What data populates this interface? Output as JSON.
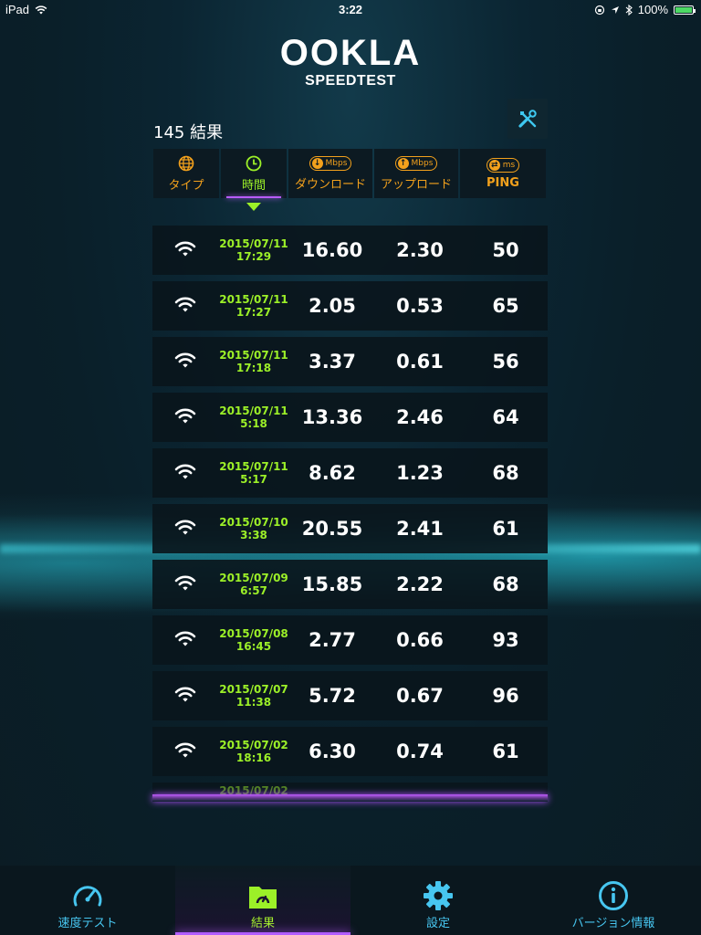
{
  "status_bar": {
    "carrier": "iPad",
    "time": "3:22",
    "battery": "100%",
    "battery_level": 1.0
  },
  "logo": {
    "brand": "OOKLA",
    "product": "SPEEDTEST"
  },
  "results": {
    "count_label": "145 結果",
    "columns": [
      {
        "label": "タイプ",
        "icon": "globe-icon"
      },
      {
        "label": "時間",
        "icon": "clock-icon",
        "active": true
      },
      {
        "label": "ダウンロード",
        "icon": "download-icon",
        "unit": "Mbps"
      },
      {
        "label": "アップロード",
        "icon": "upload-icon",
        "unit": "Mbps"
      },
      {
        "label": "PING",
        "icon": "ping-icon",
        "unit": "ms"
      }
    ],
    "rows": [
      {
        "date": "2015/07/11",
        "time": "17:29",
        "download": "16.60",
        "upload": "2.30",
        "ping": "50"
      },
      {
        "date": "2015/07/11",
        "time": "17:27",
        "download": "2.05",
        "upload": "0.53",
        "ping": "65"
      },
      {
        "date": "2015/07/11",
        "time": "17:18",
        "download": "3.37",
        "upload": "0.61",
        "ping": "56"
      },
      {
        "date": "2015/07/11",
        "time": "5:18",
        "download": "13.36",
        "upload": "2.46",
        "ping": "64"
      },
      {
        "date": "2015/07/11",
        "time": "5:17",
        "download": "8.62",
        "upload": "1.23",
        "ping": "68"
      },
      {
        "date": "2015/07/10",
        "time": "3:38",
        "download": "20.55",
        "upload": "2.41",
        "ping": "61"
      },
      {
        "date": "2015/07/09",
        "time": "6:57",
        "download": "15.85",
        "upload": "2.22",
        "ping": "68"
      },
      {
        "date": "2015/07/08",
        "time": "16:45",
        "download": "2.77",
        "upload": "0.66",
        "ping": "93"
      },
      {
        "date": "2015/07/07",
        "time": "11:38",
        "download": "5.72",
        "upload": "0.67",
        "ping": "96"
      },
      {
        "date": "2015/07/02",
        "time": "18:16",
        "download": "6.30",
        "upload": "0.74",
        "ping": "61"
      }
    ],
    "partial_row_date": "2015/07/02"
  },
  "tabs": [
    {
      "label": "速度テスト",
      "icon": "speedometer-icon"
    },
    {
      "label": "結果",
      "icon": "results-folder-icon",
      "active": true
    },
    {
      "label": "設定",
      "icon": "gear-icon"
    },
    {
      "label": "バージョン情報",
      "icon": "info-icon"
    }
  ],
  "colors": {
    "accent_green": "#9cf028",
    "accent_orange": "#f3a11c",
    "accent_blue": "#47c6f0",
    "accent_purple": "#b15cff"
  }
}
